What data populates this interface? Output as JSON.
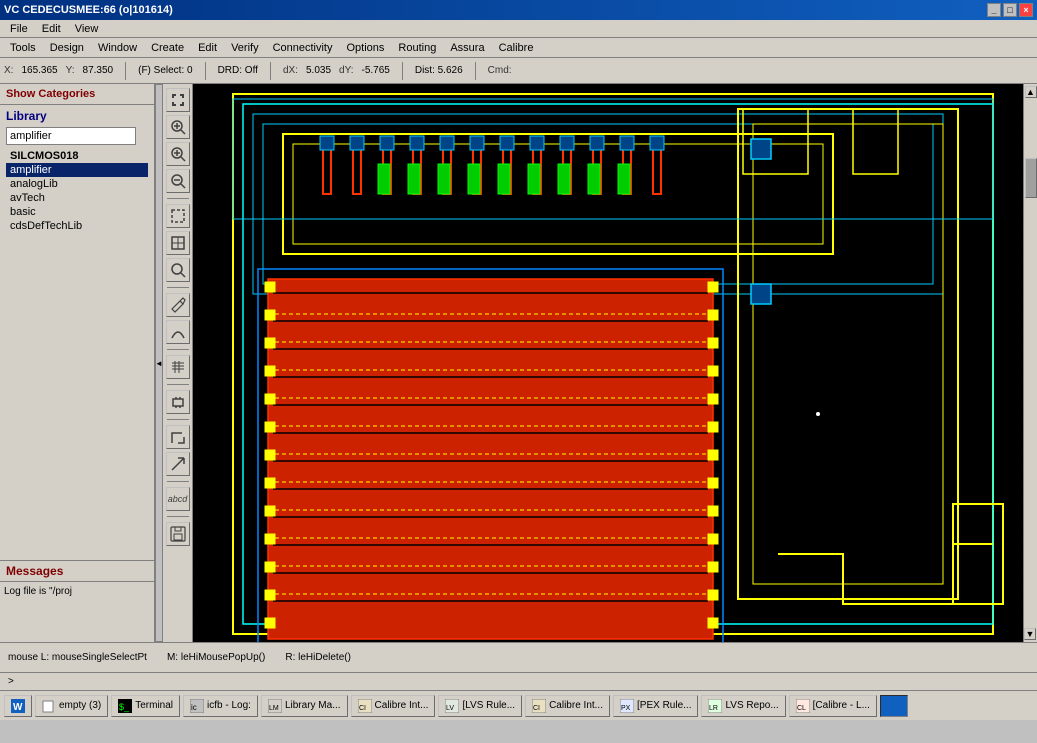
{
  "title_bar": {
    "title": "VC CEDECUSMEE:66 (o|101614)",
    "controls": [
      "_",
      "□",
      "×"
    ]
  },
  "top_menu": {
    "file": "File",
    "edit": "Edit",
    "view": "View",
    "tools": "Tools",
    "design": "Design",
    "window": "Window",
    "create": "Create",
    "edit2": "Edit",
    "verify": "Verify",
    "connectivity": "Connectivity",
    "options": "Options",
    "routing": "Routing",
    "assura": "Assura",
    "calibre": "Calibre"
  },
  "toolbar": {
    "x_label": "X:",
    "x_value": "165.365",
    "y_label": "Y:",
    "y_value": "87.350",
    "select_label": "(F) Select: 0",
    "drd_label": "DRD: Off",
    "dx_label": "dX:",
    "dx_value": "5.035",
    "dy_label": "dY:",
    "dy_value": "-5.765",
    "dist_label": "Dist: 5.626",
    "cmd_label": "Cmd:"
  },
  "left_panel": {
    "show_categories": "Show Categories",
    "library_title": "Library",
    "library_search": "amplifier",
    "items": [
      {
        "label": "SILCMOS018",
        "bold": true
      },
      {
        "label": "amplifier",
        "bold": false,
        "selected": true
      },
      {
        "label": "analogLib",
        "bold": false
      },
      {
        "label": "avTech",
        "bold": false
      },
      {
        "label": "basic",
        "bold": false
      },
      {
        "label": "cdsDefTechLib",
        "bold": false
      }
    ]
  },
  "side_tools": {
    "buttons": [
      "↙",
      "🔍",
      "🔎",
      "➕",
      "➖",
      "⬜",
      "📄",
      "🔍",
      "➕",
      "➖",
      "✏️",
      "〰️",
      "⚡",
      "📐",
      "⬅️",
      "🔲",
      "💾"
    ]
  },
  "messages": {
    "title": "Messages",
    "content": "Log file is \"/proj"
  },
  "status_bar": {
    "mouse_l": "mouse L: mouseSingleSelectPt",
    "mouse_m": "M: leHiMousePopUp()",
    "mouse_r": "R: leHiDelete()",
    "prompt": ">"
  },
  "taskbar": {
    "items": [
      {
        "label": "empty (3)",
        "icon": "window"
      },
      {
        "label": "Terminal",
        "icon": "terminal",
        "active": false
      },
      {
        "label": "icfb - Log:",
        "icon": "log"
      },
      {
        "label": "Library Ma...",
        "icon": "lib"
      },
      {
        "label": "Calibre Int...",
        "icon": "calibre"
      },
      {
        "label": "[LVS Rule...",
        "icon": "lvs"
      },
      {
        "label": "Calibre Int...",
        "icon": "calibre2"
      },
      {
        "label": "[PEX Rule...",
        "icon": "pex"
      },
      {
        "label": "LVS Repo...",
        "icon": "lvsrepo"
      },
      {
        "label": "[Calibre - L...",
        "icon": "calibrel"
      },
      {
        "label": "",
        "icon": "active",
        "active": true
      }
    ]
  },
  "colors": {
    "background": "#000000",
    "yellow": "#ffff00",
    "red": "#cc2200",
    "cyan": "#00ffff",
    "blue": "#0000ff",
    "green": "#00ff00",
    "magenta": "#ff00ff",
    "white": "#ffffff",
    "accent": "#0a246a"
  }
}
